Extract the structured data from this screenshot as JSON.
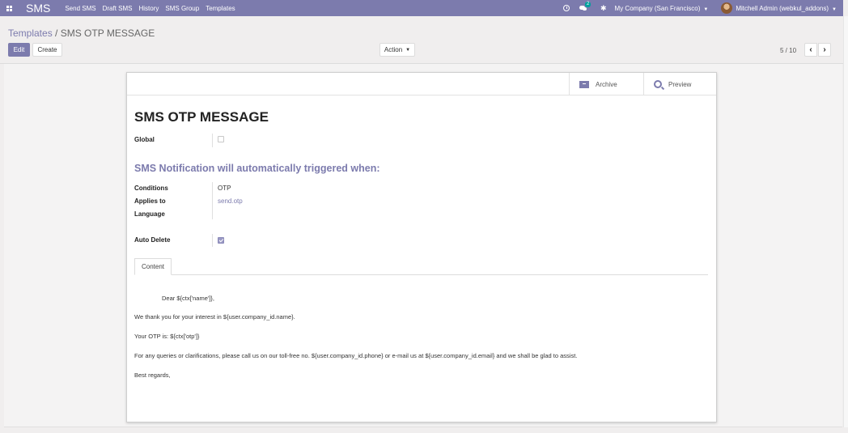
{
  "navbar": {
    "brand": "SMS",
    "menu": [
      "Send SMS",
      "Draft SMS",
      "History",
      "SMS Group",
      "Templates"
    ],
    "chat_badge": "2",
    "company": "My Company (San Francisco)",
    "user": "Mitchell Admin (webkul_addons)",
    "accent_color": "#7c7bad"
  },
  "control_panel": {
    "breadcrumb_parent": "Templates",
    "breadcrumb_sep": " / ",
    "breadcrumb_current": "SMS OTP MESSAGE",
    "edit_label": "Edit",
    "create_label": "Create",
    "action_label": "Action",
    "pager": "5 / 10"
  },
  "sheet": {
    "archive_label": "Archive",
    "preview_label": "Preview",
    "title": "SMS OTP MESSAGE",
    "global_label": "Global",
    "global_checked": false,
    "section_heading": "SMS Notification will automatically triggered when:",
    "conditions_label": "Conditions",
    "conditions_value": "OTP",
    "applies_to_label": "Applies to",
    "applies_to_value": "send.otp",
    "language_label": "Language",
    "language_value": "",
    "auto_delete_label": "Auto Delete",
    "auto_delete_checked": true,
    "tab_content": "Content",
    "body": [
      "Dear ${ctx['name']},",
      "We thank you for your interest in ${user.company_id.name}.",
      "Your OTP is: ${ctx['otp']}",
      "For any queries or clarifications, please call us on our toll-free no. ${user.company_id.phone} or e-mail us at ${user.company_id.email} and we shall be glad to assist.",
      "Best regards,"
    ]
  }
}
